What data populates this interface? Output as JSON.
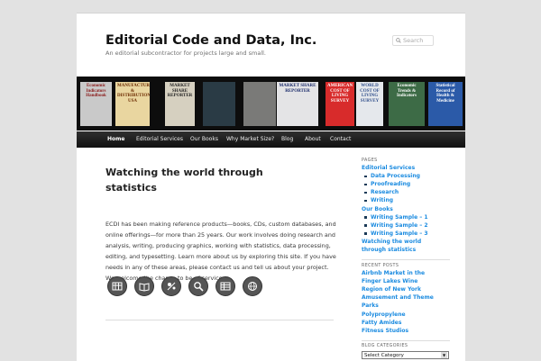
{
  "site": {
    "title": "Editorial Code and Data, Inc.",
    "description": "An editorial subcontractor for projects large and small."
  },
  "search": {
    "placeholder": "Search"
  },
  "banner": {
    "books": [
      {
        "title": "Economic Indicators Handbook",
        "bg": "#c9c9c9",
        "fg": "#8a1a1a"
      },
      {
        "title": "MANUFACTURING & DISTRIBUTION USA",
        "bg": "#e9d6a0",
        "fg": "#6b2a00"
      },
      {
        "title": "MARKET SHARE REPORTER",
        "bg": "#d6d0c0",
        "fg": "#222"
      },
      {
        "title": "",
        "bg": "#2a3b45",
        "fg": "#fff"
      },
      {
        "title": "",
        "bg": "#7a7a78",
        "fg": "#fff"
      },
      {
        "title": "MARKET SHARE REPORTER",
        "bg": "#e4e4e6",
        "fg": "#1a2a6a"
      },
      {
        "title": "AMERICAN COST OF LIVING SURVEY",
        "bg": "#d82b2b",
        "fg": "#fff"
      },
      {
        "title": "WORLD COST OF LIVING SURVEY",
        "bg": "#e5e8ec",
        "fg": "#2e4d8a"
      },
      {
        "title": "Economic Trends & Indicators",
        "bg": "#3d6b46",
        "fg": "#fff"
      },
      {
        "title": "Statistical Record of Health & Medicine",
        "bg": "#2b5aa8",
        "fg": "#fff"
      }
    ]
  },
  "nav": [
    "Home",
    "Editorial Services",
    "Our Books",
    "Why Market Size?",
    "Blog",
    "About",
    "Contact"
  ],
  "post": {
    "title": "Watching the world through statistics",
    "body": "ECDI has been making reference products—books, CDs, custom databases, and online offerings—for more than 25 years. Our work involves doing research and analysis, writing, producing graphics, working with statistics, data processing, editing, and typesetting. Learn more about us by exploring this site. If you have needs in any of these areas, please contact us and tell us about your project. We welcome the chance to be of service.",
    "icons": [
      "ledger-icon",
      "book-icon",
      "data-graphics-icon",
      "magnifier-icon",
      "spreadsheet-icon",
      "globe-icon"
    ]
  },
  "sidebar": {
    "pages_title": "PAGES",
    "pages": [
      {
        "label": "Editorial Services",
        "level": 0
      },
      {
        "label": "Data Processing",
        "level": 1
      },
      {
        "label": "Proofreading",
        "level": 1
      },
      {
        "label": "Research",
        "level": 1
      },
      {
        "label": "Writing",
        "level": 1
      },
      {
        "label": "Our Books",
        "level": 0
      },
      {
        "label": "Writing Sample – 1",
        "level": 1
      },
      {
        "label": "Writing Sample – 2",
        "level": 1
      },
      {
        "label": "Writing Sample – 3",
        "level": 1
      },
      {
        "label": "Watching the world",
        "level": 0
      },
      {
        "label": "through statistics",
        "level": 2
      }
    ],
    "recent_title": "RECENT POSTS",
    "recent": [
      "Airbnb Market in the",
      "Finger Lakes Wine",
      "Region of New York",
      "Amusement and Theme",
      "Parks",
      "Polypropylene",
      "Fatty Amides",
      "Fitness Studios"
    ],
    "categories_title": "BLOG CATEGORIES",
    "categories_select": "Select Category"
  },
  "colors": {
    "link": "#1b8be0",
    "nav_bg": "#222222",
    "banner_bg": "#0d0d0d"
  }
}
